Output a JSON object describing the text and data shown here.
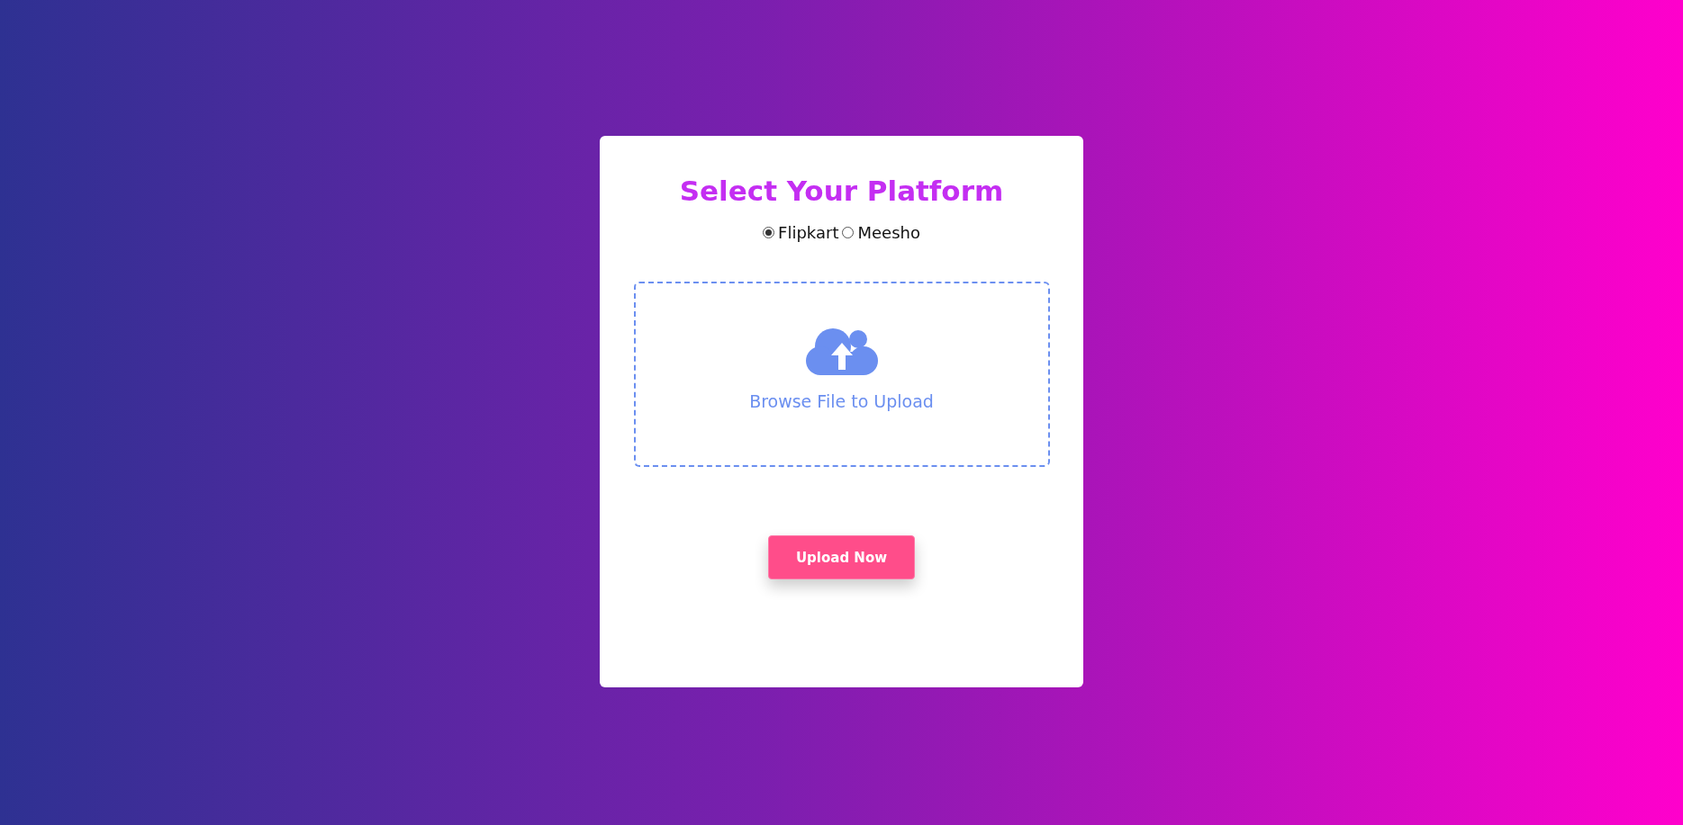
{
  "title": "Select Your Platform",
  "platforms": [
    {
      "label": "Flipkart",
      "selected": true
    },
    {
      "label": "Meesho",
      "selected": false
    }
  ],
  "dropzone": {
    "label": "Browse File to Upload"
  },
  "button": {
    "label": "Upload Now"
  }
}
